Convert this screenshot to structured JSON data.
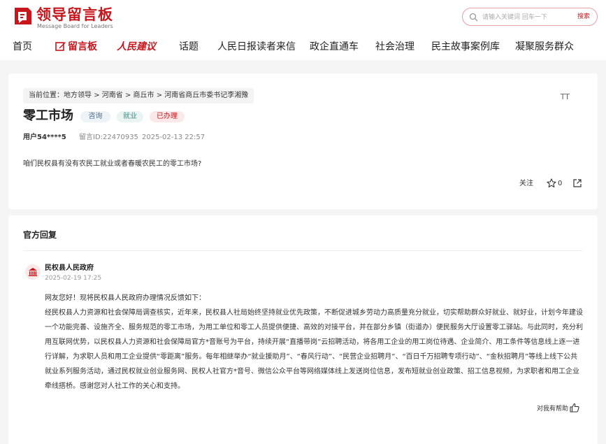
{
  "header": {
    "logo_cn": "领导留言板",
    "logo_en": "Message Board for Leaders",
    "search_placeholder": "请输入关键词 回车一下",
    "search_button": "搜索"
  },
  "nav": {
    "items": [
      "首页",
      "留言板",
      "人民建议",
      "话题",
      "人民日报读者来信",
      "政企直通车",
      "社会治理",
      "民主故事案例库",
      "凝聚服务群众"
    ]
  },
  "question": {
    "breadcrumb": {
      "prefix": "当前位置：",
      "items": [
        "地方领导",
        "河南省",
        "商丘市",
        "河南省商丘市委书记李湘豫"
      ],
      "separator": ">"
    },
    "font_size_icon": "TT",
    "title": "零工市场",
    "tags": [
      "咨询",
      "就业",
      "已办理"
    ],
    "user": "用户54****5",
    "message_id": "留言ID:22470935",
    "date": "2025-02-13 22:57",
    "body": "咱们民权县有没有农民工就业或者春暖农民工的零工市场?",
    "follow_label": "关注",
    "star_count": "0"
  },
  "reply": {
    "heading": "官方回复",
    "org": "民权县人民政府",
    "date": "2025-02-19 17:25",
    "greeting": "网友您好！现将民权县人民政府办理情况反馈如下：",
    "body": "经民权县人力资源和社会保障局调查核实，近年来，民权县人社局始终坚持就业优先政策，不断促进城乡劳动力高质量充分就业，切实帮助群众好就业、就好业，计划今年建设一个功能完善、设施齐全、服务规范的零工市场，为用工单位和零工人员提供便捷、高效的对接平台，并在部分乡镇（街道办）便民服务大厅设置零工驿站。与此同时，充分利用互联网优势，以民权县人力资源和社会保障局官方*音账号为平台，持续开展“直播带岗”云招聘活动，将各用工企业的用工岗位待遇、企业简介、用工条件等信息线上逐一进行详解，为求职人员和用工企业提供“零距离”服务。每年相继举办“就业援助月”、“春风行动”、“民营企业招聘月”、“百日千万招聘专项行动”、“金秋招聘月”等线上线下公共就业系列服务活动，通过民权就业创业服务网、民权人社官方*音号、微信公众平台等网络媒体线上发送岗位信息，发布短就业创业政策、招工信息视频，为求职者和用工企业牵线搭桥。感谢您对人社工作的关心和支持。",
    "helpful_label": "对我有帮助"
  },
  "colors": {
    "brand_red": "#c8161d",
    "page_bg": "#f5f5f5"
  }
}
